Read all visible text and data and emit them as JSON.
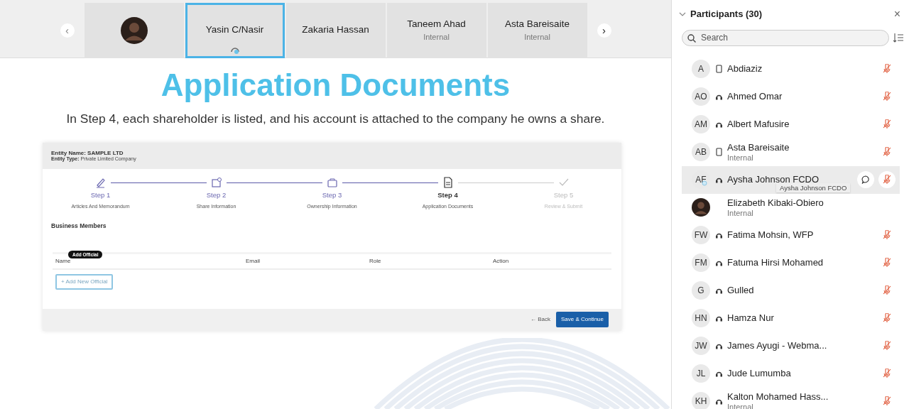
{
  "stage": {
    "prev_label": "‹",
    "next_label": "›",
    "tiles": [
      {
        "kind": "photo",
        "selected": false,
        "connecting": false
      },
      {
        "kind": "name",
        "name": "Yasin C/Nasir",
        "selected": true,
        "connecting": true
      },
      {
        "kind": "name",
        "name": "Zakaria Hassan",
        "selected": false,
        "connecting": false
      },
      {
        "kind": "name",
        "name": "Taneem Ahad",
        "subtitle": "Internal",
        "selected": false,
        "connecting": false
      },
      {
        "kind": "name",
        "name": "Asta Bareisaite",
        "subtitle": "Internal",
        "selected": false,
        "connecting": false
      }
    ]
  },
  "slide": {
    "title": "Application Documents",
    "subtitle": "In Step 4, each shareholder is listed, and his account is attached to the company he owns a share.",
    "form": {
      "entity_name_label": "Entity Name:",
      "entity_name": "SAMPLE LTD",
      "entity_type_label": "Entity Type:",
      "entity_type": "Private Limited Company",
      "steps": [
        {
          "label": "Step 1",
          "caption": "Articles And Memorandum",
          "completed": true,
          "selected": false
        },
        {
          "label": "Step 2",
          "caption": "Share Information",
          "completed": true,
          "selected": false
        },
        {
          "label": "Step 3",
          "caption": "Ownership Information",
          "completed": true,
          "selected": false
        },
        {
          "label": "Step 4",
          "caption": "Application Documents",
          "completed": false,
          "selected": true
        },
        {
          "label": "Step 5",
          "caption": "Review & Submit",
          "completed": false,
          "selected": false
        }
      ],
      "section_title": "Business Members",
      "columns": [
        "Name",
        "Email",
        "Role",
        "Action"
      ],
      "add_button": "+ Add New Official",
      "add_tooltip": "Add Official",
      "back_button": "← Back",
      "save_button": "Save & Continue"
    }
  },
  "participants": {
    "title": "Participants (30)",
    "close": "×",
    "search": {
      "placeholder": "Search"
    },
    "tooltip": "Aysha Johnson FCDO",
    "items": [
      {
        "initials": "A",
        "photo": false,
        "kind": "phone",
        "name": "Abdiaziz",
        "muted": true,
        "selected": false
      },
      {
        "initials": "AO",
        "photo": false,
        "kind": "headset",
        "name": "Ahmed Omar",
        "muted": true,
        "selected": false
      },
      {
        "initials": "AM",
        "photo": false,
        "kind": "headset",
        "name": "Albert Mafusire",
        "muted": true,
        "selected": false
      },
      {
        "initials": "AB",
        "photo": false,
        "kind": "phone",
        "name": "Asta Bareisaite",
        "subtitle": "Internal",
        "muted": true,
        "selected": false
      },
      {
        "initials": "AF",
        "photo": false,
        "kind": "headset",
        "name": "Aysha Johnson FCDO",
        "muted": true,
        "selected": true
      },
      {
        "photo": true,
        "kind": "none",
        "name": "Elizabeth Kibaki-Obiero",
        "subtitle": "Internal",
        "muted": false,
        "selected": false
      },
      {
        "initials": "FW",
        "photo": false,
        "kind": "headset",
        "name": "Fatima Mohsin, WFP",
        "muted": true,
        "selected": false
      },
      {
        "initials": "FM",
        "photo": false,
        "kind": "headset",
        "name": "Fatuma Hirsi Mohamed",
        "muted": true,
        "selected": false
      },
      {
        "initials": "G",
        "photo": false,
        "kind": "headset",
        "name": "Gulled",
        "muted": true,
        "selected": false
      },
      {
        "initials": "HN",
        "photo": false,
        "kind": "headset",
        "name": "Hamza Nur",
        "muted": true,
        "selected": false
      },
      {
        "initials": "JW",
        "photo": false,
        "kind": "headset",
        "name": "James Ayugi - Webma...",
        "muted": true,
        "selected": false
      },
      {
        "initials": "JL",
        "photo": false,
        "kind": "headset",
        "name": "Jude Lumumba",
        "muted": true,
        "selected": false
      },
      {
        "initials": "KH",
        "photo": false,
        "kind": "headset",
        "name": "Kalton Mohamed Hass...",
        "subtitle": "Internal",
        "muted": true,
        "selected": false
      }
    ]
  }
}
